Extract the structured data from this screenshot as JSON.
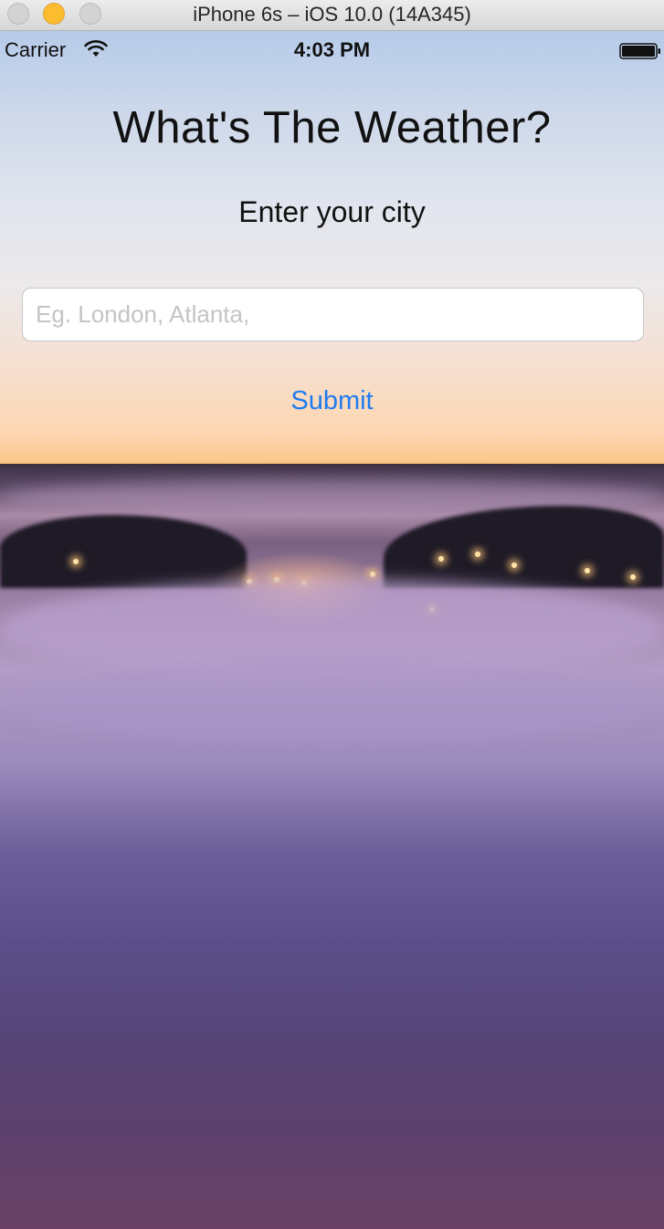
{
  "window": {
    "title": "iPhone 6s – iOS 10.0 (14A345)"
  },
  "status_bar": {
    "carrier": "Carrier",
    "time": "4:03 PM",
    "icons": [
      "wifi-icon",
      "battery-icon"
    ]
  },
  "app": {
    "title": "What's The Weather?",
    "subtitle": "Enter your city",
    "city_input": {
      "value": "",
      "placeholder": "Eg. London, Atlanta,"
    },
    "submit_label": "Submit"
  },
  "colors": {
    "accent": "#1f7cf0",
    "minimize_button": "#fcbc2f"
  }
}
